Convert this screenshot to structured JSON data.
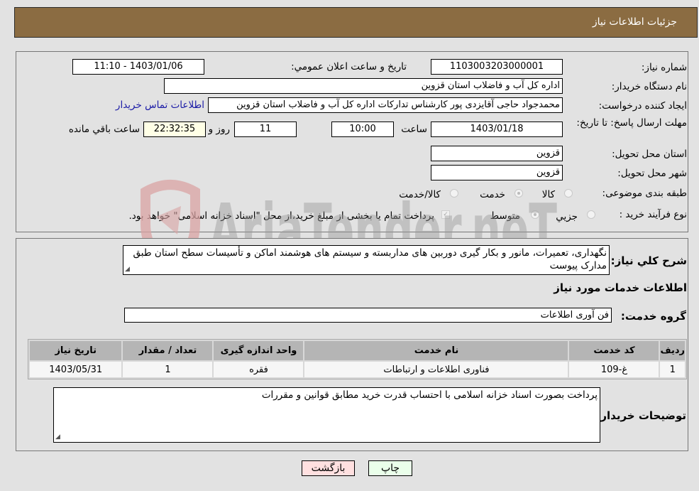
{
  "header": {
    "title": "جزئیات اطلاعات نیاز"
  },
  "info": {
    "need_number_label": "شماره نیاز:",
    "need_number": "1103003203000001",
    "announce_label": "تاریخ و ساعت اعلان عمومي:",
    "announce_value": "1403/01/06 - 11:10",
    "buyer_org_label": "نام دستگاه خريدار:",
    "buyer_org": "اداره کل آب و فاضلاب استان قزوین",
    "creator_label": "ایجاد کننده درخواست:",
    "creator": "محمدجواد حاجی آقایزدی پور کارشناس تدارکات اداره کل آب و فاضلاب استان قزوین",
    "contact_link": "اطلاعات تماس خریدار",
    "deadline_label": "مهلت ارسال پاسخ: تا تاریخ:",
    "deadline_date": "1403/01/18",
    "time_label": "ساعت",
    "deadline_time": "10:00",
    "days_value": "11",
    "days_label": "روز و",
    "remaining_time": "22:32:35",
    "remaining_label": "ساعت باقي مانده",
    "province_label": "استان محل تحویل:",
    "province": "قزوین",
    "city_label": "شهر محل تحویل:",
    "city": "قزوین",
    "category_label": "طبقه بندی موضوعی:",
    "category_options": [
      "کالا",
      "خدمت",
      "کالا/خدمت"
    ],
    "category_selected": "خدمت",
    "process_label": "نوع فرآیند خرید :",
    "process_options": [
      "جزیي",
      "متوسط"
    ],
    "process_selected": "متوسط",
    "treasury_note": "پرداخت تمام یا بخشی از مبلغ خرید،از محل \"اسناد خزانه اسلامی\" خواهد بود.",
    "treasury_checked": true
  },
  "description": {
    "label": "شرح کلي نياز:",
    "text": "نگهداری، تعمیرات، مانور و بکار گیری دوربین های مداربسته و سیستم های هوشمند اماکن و تأسیسات سطح استان طبق مدارک پیوست"
  },
  "services": {
    "section_title": "اطلاعات خدمات مورد نیاز",
    "group_label": "گروه خدمت:",
    "group_value": "فن آوری اطلاعات",
    "columns": [
      "ردیف",
      "کد خدمت",
      "نام خدمت",
      "واحد اندازه گیری",
      "تعداد / مقدار",
      "تاریخ نیاز"
    ],
    "rows": [
      [
        "1",
        "غ-109",
        "فناوری اطلاعات و ارتباطات",
        "فقره",
        "1",
        "1403/05/31"
      ]
    ]
  },
  "buyer_notes": {
    "label": "توضیحات خریدار:",
    "text": "پرداخت بصورت اسناد خزانه اسلامی با احتساب قدرت خرید مطابق قوانین و مقررات"
  },
  "buttons": {
    "print": "چاپ",
    "back": "بازگشت"
  },
  "watermark": {
    "text": "AriaTender.neT"
  }
}
